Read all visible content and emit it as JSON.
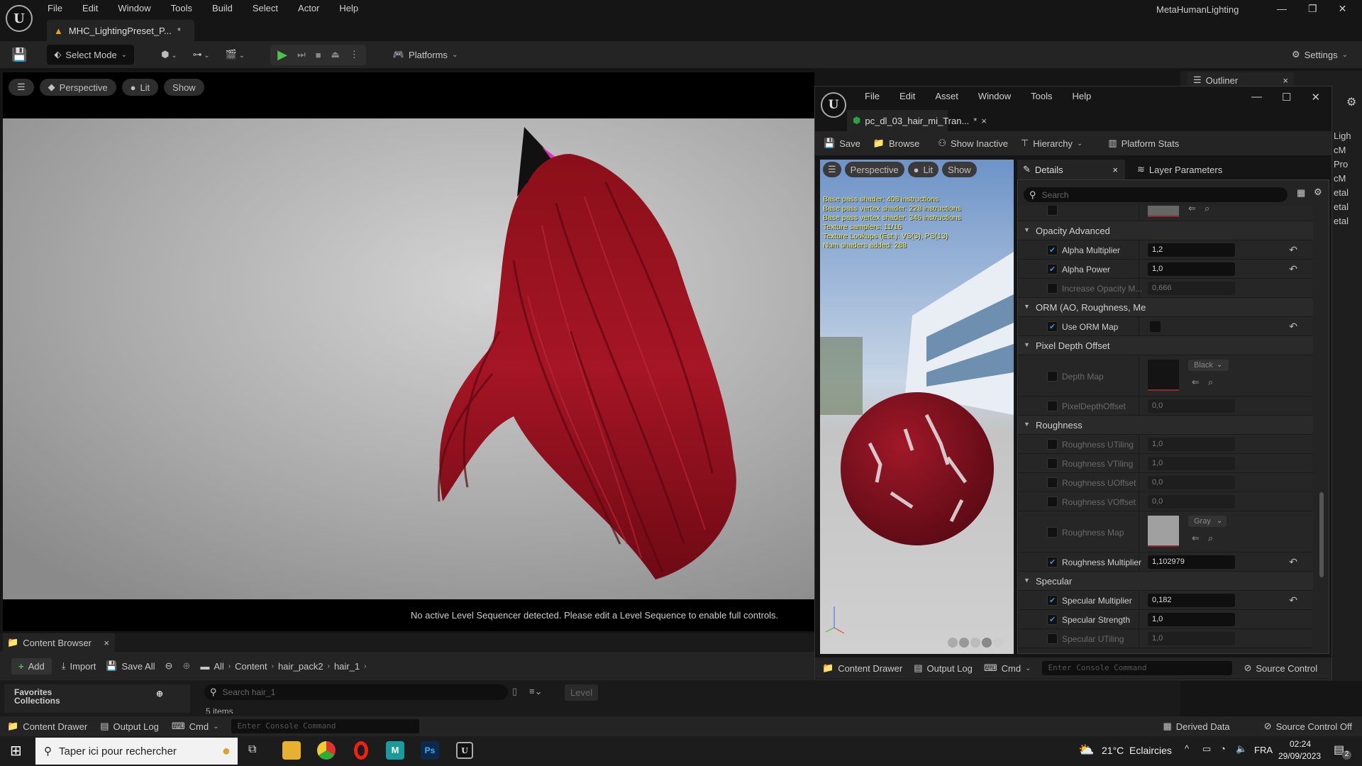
{
  "app": {
    "window_title": "MetaHumanLighting",
    "menu": [
      "File",
      "Edit",
      "Window",
      "Tools",
      "Build",
      "Select",
      "Actor",
      "Help"
    ],
    "level_tab": "MHC_LightingPreset_P...",
    "level_tab_dirty": "*"
  },
  "toolbar": {
    "select_mode": "Select Mode",
    "platforms": "Platforms",
    "settings": "Settings"
  },
  "viewport": {
    "perspective": "Perspective",
    "lit": "Lit",
    "show": "Show",
    "message": "No active Level Sequencer detected. Please edit a Level Sequence to enable full controls."
  },
  "outliner": {
    "title": "Outliner",
    "items": [
      "Ligh",
      "cM",
      "Pro",
      "cM",
      "etal",
      "etal",
      "etal"
    ]
  },
  "material_editor": {
    "menu": [
      "File",
      "Edit",
      "Asset",
      "Window",
      "Tools",
      "Help"
    ],
    "tab": "pc_dl_03_hair_mi_Tran...",
    "tab_dirty": "*",
    "toolbar": {
      "save": "Save",
      "browse": "Browse",
      "show_inactive": "Show Inactive",
      "hierarchy": "Hierarchy",
      "platform_stats": "Platform Stats"
    },
    "preview": {
      "perspective": "Perspective",
      "lit": "Lit",
      "show": "Show",
      "stats": [
        "Base pass shader: 408 instructions",
        "Base pass vertex shader: 228 instructions",
        "Base pass vertex shader: 346 instructions",
        "Texture samplers: 11/16",
        "Texture Lookups (Est.): VS(3), PS(13)",
        "Num shaders added: 288"
      ]
    },
    "details": {
      "tab": "Details",
      "layer_tab": "Layer Parameters",
      "search_placeholder": "Search",
      "rows": [
        {
          "type": "tex",
          "h": 32,
          "name": "",
          "enabled": false,
          "thumb": "#666"
        },
        {
          "type": "hdr",
          "name": "Opacity Advanced"
        },
        {
          "type": "prop",
          "name": "Alpha Multiplier",
          "value": "1,2",
          "checked": true,
          "enabled": true,
          "reset": true
        },
        {
          "type": "prop",
          "name": "Alpha Power",
          "value": "1,0",
          "checked": true,
          "enabled": true,
          "reset": true
        },
        {
          "type": "prop",
          "name": "Increase Opacity M...",
          "value": "0,666",
          "checked": false,
          "enabled": false
        },
        {
          "type": "hdr",
          "name": "ORM (AO, Roughness, Me"
        },
        {
          "type": "bool",
          "name": "Use ORM Map",
          "checked": true,
          "enabled": true,
          "reset": true
        },
        {
          "type": "hdr",
          "name": "Pixel Depth Offset"
        },
        {
          "type": "tex",
          "h": 58,
          "name": "Depth Map",
          "checked": false,
          "enabled": false,
          "thumb": "#141414",
          "option": "Black"
        },
        {
          "type": "prop",
          "name": "PixelDepthOffset",
          "value": "0,0",
          "checked": false,
          "enabled": false
        },
        {
          "type": "hdr",
          "name": "Roughness"
        },
        {
          "type": "prop",
          "name": "Roughness UTiling",
          "value": "1,0",
          "checked": false,
          "enabled": false
        },
        {
          "type": "prop",
          "name": "Roughness VTiling",
          "value": "1,0",
          "checked": false,
          "enabled": false
        },
        {
          "type": "prop",
          "name": "Roughness UOffset",
          "value": "0,0",
          "checked": false,
          "enabled": false
        },
        {
          "type": "prop",
          "name": "Roughness VOffset",
          "value": "0,0",
          "checked": false,
          "enabled": false
        },
        {
          "type": "tex",
          "h": 58,
          "name": "Roughness Map",
          "checked": false,
          "enabled": false,
          "thumb": "#a0a0a0",
          "option": "Gray"
        },
        {
          "type": "prop",
          "name": "Roughness Multiplier",
          "value": "1,102979",
          "checked": true,
          "enabled": true,
          "reset": true
        },
        {
          "type": "hdr",
          "name": "Specular"
        },
        {
          "type": "prop",
          "name": "Specular Multiplier",
          "value": "0,182",
          "checked": true,
          "enabled": true,
          "reset": true
        },
        {
          "type": "prop",
          "name": "Specular Strength",
          "value": "1,0",
          "checked": true,
          "enabled": true
        },
        {
          "type": "prop",
          "name": "Specular UTiling",
          "value": "1,0",
          "checked": false,
          "enabled": false
        }
      ]
    },
    "statusbar": {
      "content_drawer": "Content Drawer",
      "output_log": "Output Log",
      "cmd": "Cmd",
      "console_placeholder": "Enter Console Command",
      "source_control": "Source Control"
    }
  },
  "content_browser": {
    "title": "Content Browser",
    "add": "Add",
    "import": "Import",
    "save_all": "Save All",
    "breadcrumb": [
      "All",
      "Content",
      "hair_pack2",
      "hair_1"
    ],
    "favorites": "Favorites",
    "collections": "Collections",
    "search_placeholder": "Search hair_1",
    "level_filter": "Level",
    "items_count": "5 items"
  },
  "statusbar": {
    "content_drawer": "Content Drawer",
    "output_log": "Output Log",
    "cmd": "Cmd",
    "console_placeholder": "Enter Console Command",
    "derived_data": "Derived Data",
    "source_control": "Source Control Off"
  },
  "taskbar": {
    "search_placeholder": "Taper ici pour rechercher",
    "weather_temp": "21°C",
    "weather_text": "Eclaircies",
    "language": "FRA",
    "time": "02:24",
    "date": "29/09/2023",
    "notifications": "2"
  }
}
